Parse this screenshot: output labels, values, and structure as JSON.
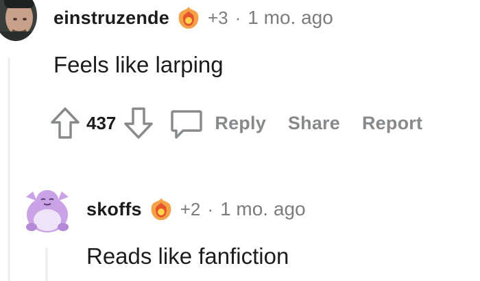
{
  "comments": [
    {
      "username": "einstruzende",
      "flair_icon": "flame-flair-icon",
      "karma": "+3",
      "separator": "·",
      "time": "1 mo. ago",
      "body": "Feels like larping",
      "votes": "437",
      "actions": {
        "reply": "Reply",
        "share": "Share",
        "report": "Report"
      }
    },
    {
      "username": "skoffs",
      "flair_icon": "flame-flair-icon",
      "karma": "+2",
      "separator": "·",
      "time": "1 mo. ago",
      "body": "Reads like fanfiction"
    }
  ],
  "colors": {
    "text": "#1c1c1c",
    "meta": "#7c7c7c",
    "action": "#878a8c",
    "thread_line": "#edeff1",
    "avatar_purple": "#c9a3e6"
  }
}
